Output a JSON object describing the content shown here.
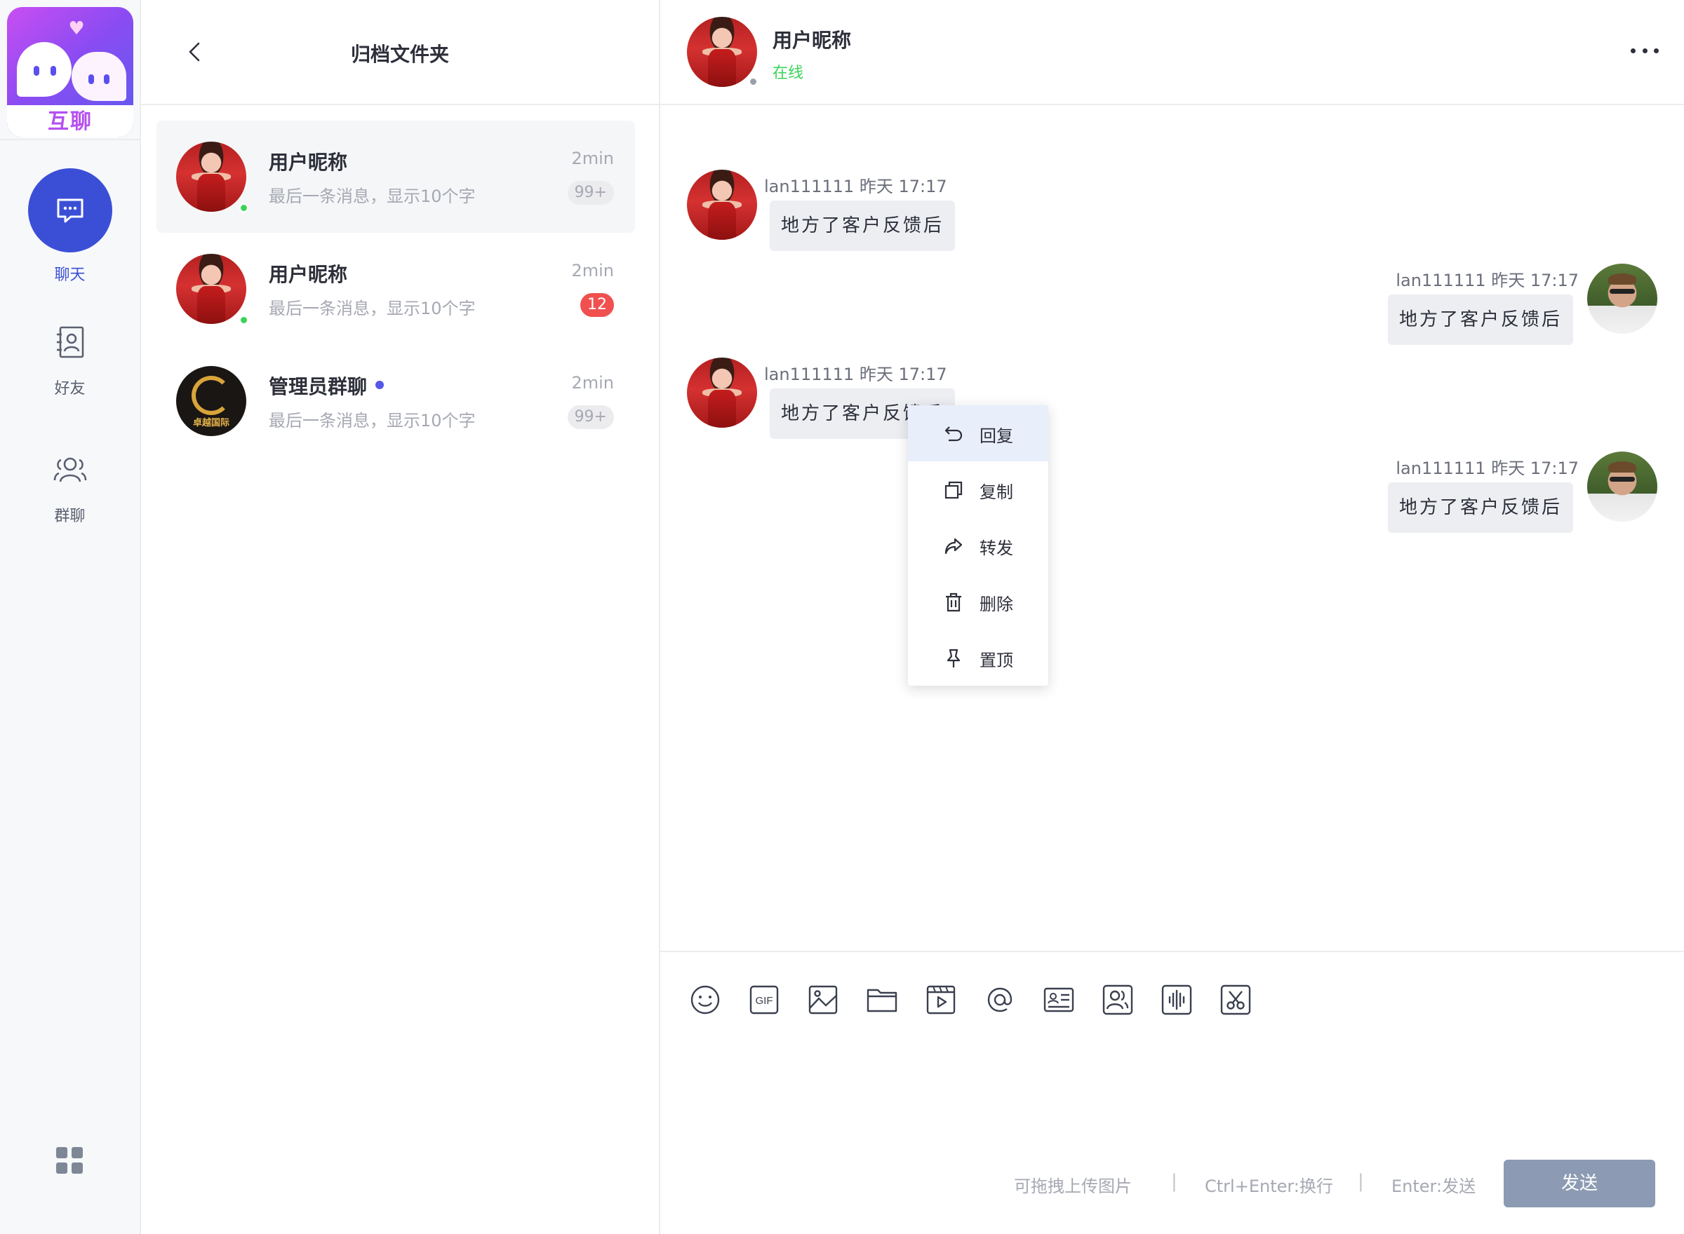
{
  "app": {
    "logo_text": "互聊"
  },
  "nav": {
    "chat_label": "聊天",
    "friends_label": "好友",
    "groups_label": "群聊"
  },
  "list": {
    "title": "归档文件夹",
    "conversations": [
      {
        "name": "用户昵称",
        "preview": "最后一条消息，显示10个字",
        "time": "2min",
        "badge": "99+",
        "online": true
      },
      {
        "name": "用户昵称",
        "preview": "最后一条消息，显示10个字",
        "time": "2min",
        "badge": "12",
        "online": true
      },
      {
        "name": "管理员群聊",
        "preview": "最后一条消息，显示10个字",
        "time": "2min",
        "badge": "99+",
        "avatar_text": "卓越国际"
      }
    ]
  },
  "chat": {
    "name": "用户昵称",
    "status": "在线",
    "messages": [
      {
        "direction": "in",
        "meta": "lan111111 昨天 17:17",
        "text": "地方了客户反馈后"
      },
      {
        "direction": "out",
        "meta": "lan111111 昨天 17:17",
        "text": "地方了客户反馈后"
      },
      {
        "direction": "in",
        "meta": "lan111111 昨天 17:17",
        "text": "地方了客户反馈后"
      },
      {
        "direction": "out",
        "meta": "lan111111 昨天 17:17",
        "text": "地方了客户反馈后"
      }
    ]
  },
  "context_menu": {
    "items": [
      {
        "label": "回复",
        "icon": "reply-icon"
      },
      {
        "label": "复制",
        "icon": "copy-icon"
      },
      {
        "label": "转发",
        "icon": "forward-icon"
      },
      {
        "label": "删除",
        "icon": "trash-icon"
      },
      {
        "label": "置顶",
        "icon": "pin-icon"
      }
    ]
  },
  "composer": {
    "tools": [
      "emoji-icon",
      "gif-icon",
      "image-icon",
      "folder-icon",
      "video-icon",
      "mention-icon",
      "contact-card-icon",
      "friends-icon",
      "voice-icon",
      "screenshot-icon"
    ],
    "gif_label": "GIF",
    "hint_drag": "可拖拽上传图片",
    "hint_newline": "Ctrl+Enter:换行",
    "hint_send": "Enter:发送",
    "separator": "|",
    "send_label": "发送"
  },
  "colors": {
    "accent": "#3b4fd6",
    "online": "#3ad35a",
    "badge_red": "#f0504f",
    "send_button": "#8c9bb3"
  }
}
